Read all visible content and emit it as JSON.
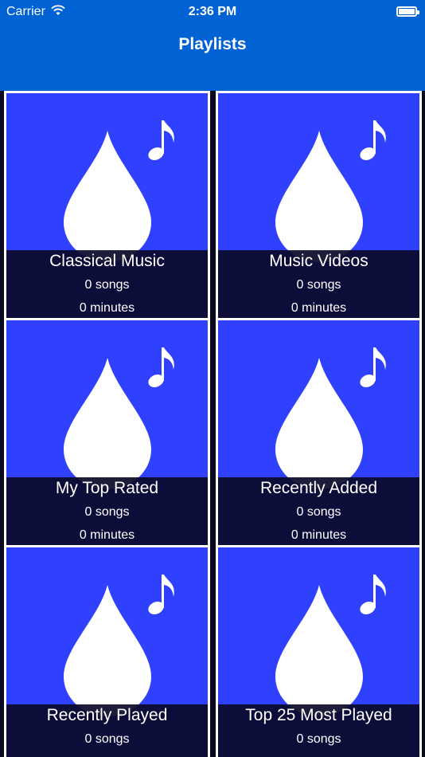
{
  "status_bar": {
    "carrier": "Carrier",
    "time": "2:36 PM",
    "wifi_icon": "wifi-icon",
    "battery_icon": "battery-icon"
  },
  "nav": {
    "title": "Playlists"
  },
  "colors": {
    "nav_background": "#0062D3",
    "tile_background": "#3040FF",
    "caption_background": "#0A0A28",
    "text": "#FFFFFF"
  },
  "playlists": [
    {
      "name": "Classical Music",
      "songs": "0 songs",
      "minutes": "0 minutes",
      "icon": "music-note-icon"
    },
    {
      "name": "Music Videos",
      "songs": "0 songs",
      "minutes": "0 minutes",
      "icon": "music-note-icon"
    },
    {
      "name": "My Top Rated",
      "songs": "0 songs",
      "minutes": "0 minutes",
      "icon": "music-note-icon"
    },
    {
      "name": "Recently Added",
      "songs": "0 songs",
      "minutes": "0 minutes",
      "icon": "music-note-icon"
    },
    {
      "name": "Recently Played",
      "songs": "0 songs",
      "minutes": "",
      "icon": "music-note-icon"
    },
    {
      "name": "Top 25 Most Played",
      "songs": "0 songs",
      "minutes": "",
      "icon": "music-note-icon"
    }
  ]
}
